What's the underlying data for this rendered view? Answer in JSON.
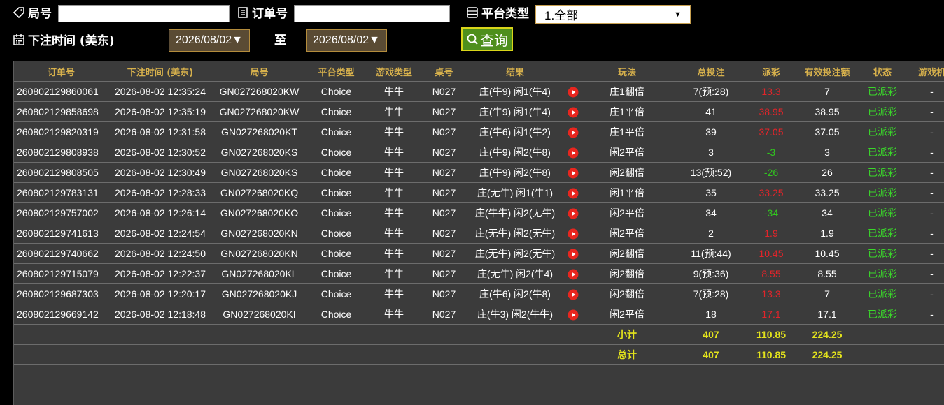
{
  "filters": {
    "round_label": "局号",
    "round_value": "",
    "order_label": "订单号",
    "order_value": "",
    "platform_label": "平台类型",
    "platform_selected": "1.全部",
    "time_label": "下注时间 (美东)",
    "date_from": "2026/08/02▼",
    "to_label": "至",
    "date_to": "2026/08/02▼",
    "query_label": "查询"
  },
  "table": {
    "headers": [
      "订单号",
      "下注时间 (美东)",
      "局号",
      "平台类型",
      "游戏类型",
      "桌号",
      "结果",
      "",
      "玩法",
      "总投注",
      "派彩",
      "有效投注额",
      "状态",
      "游戏机"
    ],
    "rows": [
      {
        "order": "260802129860061",
        "time": "2026-08-02 12:35:24",
        "round": "GN027268020KW",
        "platform": "Choice",
        "game": "牛牛",
        "table": "N027",
        "result": "庄(牛9) 闲1(牛4)",
        "play": "庄1翻倍",
        "bet": "7(预:28)",
        "payout": "13.3",
        "payout_color": "red",
        "valid": "7",
        "status": "已派彩",
        "machine": "-"
      },
      {
        "order": "260802129858698",
        "time": "2026-08-02 12:35:19",
        "round": "GN027268020KW",
        "platform": "Choice",
        "game": "牛牛",
        "table": "N027",
        "result": "庄(牛9) 闲1(牛4)",
        "play": "庄1平倍",
        "bet": "41",
        "payout": "38.95",
        "payout_color": "red",
        "valid": "38.95",
        "status": "已派彩",
        "machine": "-"
      },
      {
        "order": "260802129820319",
        "time": "2026-08-02 12:31:58",
        "round": "GN027268020KT",
        "platform": "Choice",
        "game": "牛牛",
        "table": "N027",
        "result": "庄(牛6) 闲1(牛2)",
        "play": "庄1平倍",
        "bet": "39",
        "payout": "37.05",
        "payout_color": "red",
        "valid": "37.05",
        "status": "已派彩",
        "machine": "-"
      },
      {
        "order": "260802129808938",
        "time": "2026-08-02 12:30:52",
        "round": "GN027268020KS",
        "platform": "Choice",
        "game": "牛牛",
        "table": "N027",
        "result": "庄(牛9) 闲2(牛8)",
        "play": "闲2平倍",
        "bet": "3",
        "payout": "-3",
        "payout_color": "green",
        "valid": "3",
        "status": "已派彩",
        "machine": "-"
      },
      {
        "order": "260802129808505",
        "time": "2026-08-02 12:30:49",
        "round": "GN027268020KS",
        "platform": "Choice",
        "game": "牛牛",
        "table": "N027",
        "result": "庄(牛9) 闲2(牛8)",
        "play": "闲2翻倍",
        "bet": "13(预:52)",
        "payout": "-26",
        "payout_color": "green",
        "valid": "26",
        "status": "已派彩",
        "machine": "-"
      },
      {
        "order": "260802129783131",
        "time": "2026-08-02 12:28:33",
        "round": "GN027268020KQ",
        "platform": "Choice",
        "game": "牛牛",
        "table": "N027",
        "result": "庄(无牛) 闲1(牛1)",
        "play": "闲1平倍",
        "bet": "35",
        "payout": "33.25",
        "payout_color": "red",
        "valid": "33.25",
        "status": "已派彩",
        "machine": "-"
      },
      {
        "order": "260802129757002",
        "time": "2026-08-02 12:26:14",
        "round": "GN027268020KO",
        "platform": "Choice",
        "game": "牛牛",
        "table": "N027",
        "result": "庄(牛牛) 闲2(无牛)",
        "play": "闲2平倍",
        "bet": "34",
        "payout": "-34",
        "payout_color": "green",
        "valid": "34",
        "status": "已派彩",
        "machine": "-"
      },
      {
        "order": "260802129741613",
        "time": "2026-08-02 12:24:54",
        "round": "GN027268020KN",
        "platform": "Choice",
        "game": "牛牛",
        "table": "N027",
        "result": "庄(无牛) 闲2(无牛)",
        "play": "闲2平倍",
        "bet": "2",
        "payout": "1.9",
        "payout_color": "red",
        "valid": "1.9",
        "status": "已派彩",
        "machine": "-"
      },
      {
        "order": "260802129740662",
        "time": "2026-08-02 12:24:50",
        "round": "GN027268020KN",
        "platform": "Choice",
        "game": "牛牛",
        "table": "N027",
        "result": "庄(无牛) 闲2(无牛)",
        "play": "闲2翻倍",
        "bet": "11(预:44)",
        "payout": "10.45",
        "payout_color": "red",
        "valid": "10.45",
        "status": "已派彩",
        "machine": "-"
      },
      {
        "order": "260802129715079",
        "time": "2026-08-02 12:22:37",
        "round": "GN027268020KL",
        "platform": "Choice",
        "game": "牛牛",
        "table": "N027",
        "result": "庄(无牛) 闲2(牛4)",
        "play": "闲2翻倍",
        "bet": "9(预:36)",
        "payout": "8.55",
        "payout_color": "red",
        "valid": "8.55",
        "status": "已派彩",
        "machine": "-"
      },
      {
        "order": "260802129687303",
        "time": "2026-08-02 12:20:17",
        "round": "GN027268020KJ",
        "platform": "Choice",
        "game": "牛牛",
        "table": "N027",
        "result": "庄(牛6) 闲2(牛8)",
        "play": "闲2翻倍",
        "bet": "7(预:28)",
        "payout": "13.3",
        "payout_color": "red",
        "valid": "7",
        "status": "已派彩",
        "machine": "-"
      },
      {
        "order": "260802129669142",
        "time": "2026-08-02 12:18:48",
        "round": "GN027268020KI",
        "platform": "Choice",
        "game": "牛牛",
        "table": "N027",
        "result": "庄(牛3) 闲2(牛牛)",
        "play": "闲2平倍",
        "bet": "18",
        "payout": "17.1",
        "payout_color": "red",
        "valid": "17.1",
        "status": "已派彩",
        "machine": "-"
      }
    ],
    "subtotal": {
      "label": "小计",
      "bet": "407",
      "payout": "110.85",
      "valid": "224.25"
    },
    "total": {
      "label": "总计",
      "bet": "407",
      "payout": "110.85",
      "valid": "224.25"
    }
  },
  "colors": {
    "header_text": "#d6b04c",
    "payout_positive": "#e2242a",
    "payout_negative": "#31c61f",
    "status": "#3ad82a",
    "summary": "#e3e31c"
  },
  "icons": {
    "play": "play-circle-icon",
    "tag": "tag-icon",
    "document": "document-icon",
    "list": "list-icon",
    "calendar": "calendar-icon",
    "search": "search-icon"
  }
}
